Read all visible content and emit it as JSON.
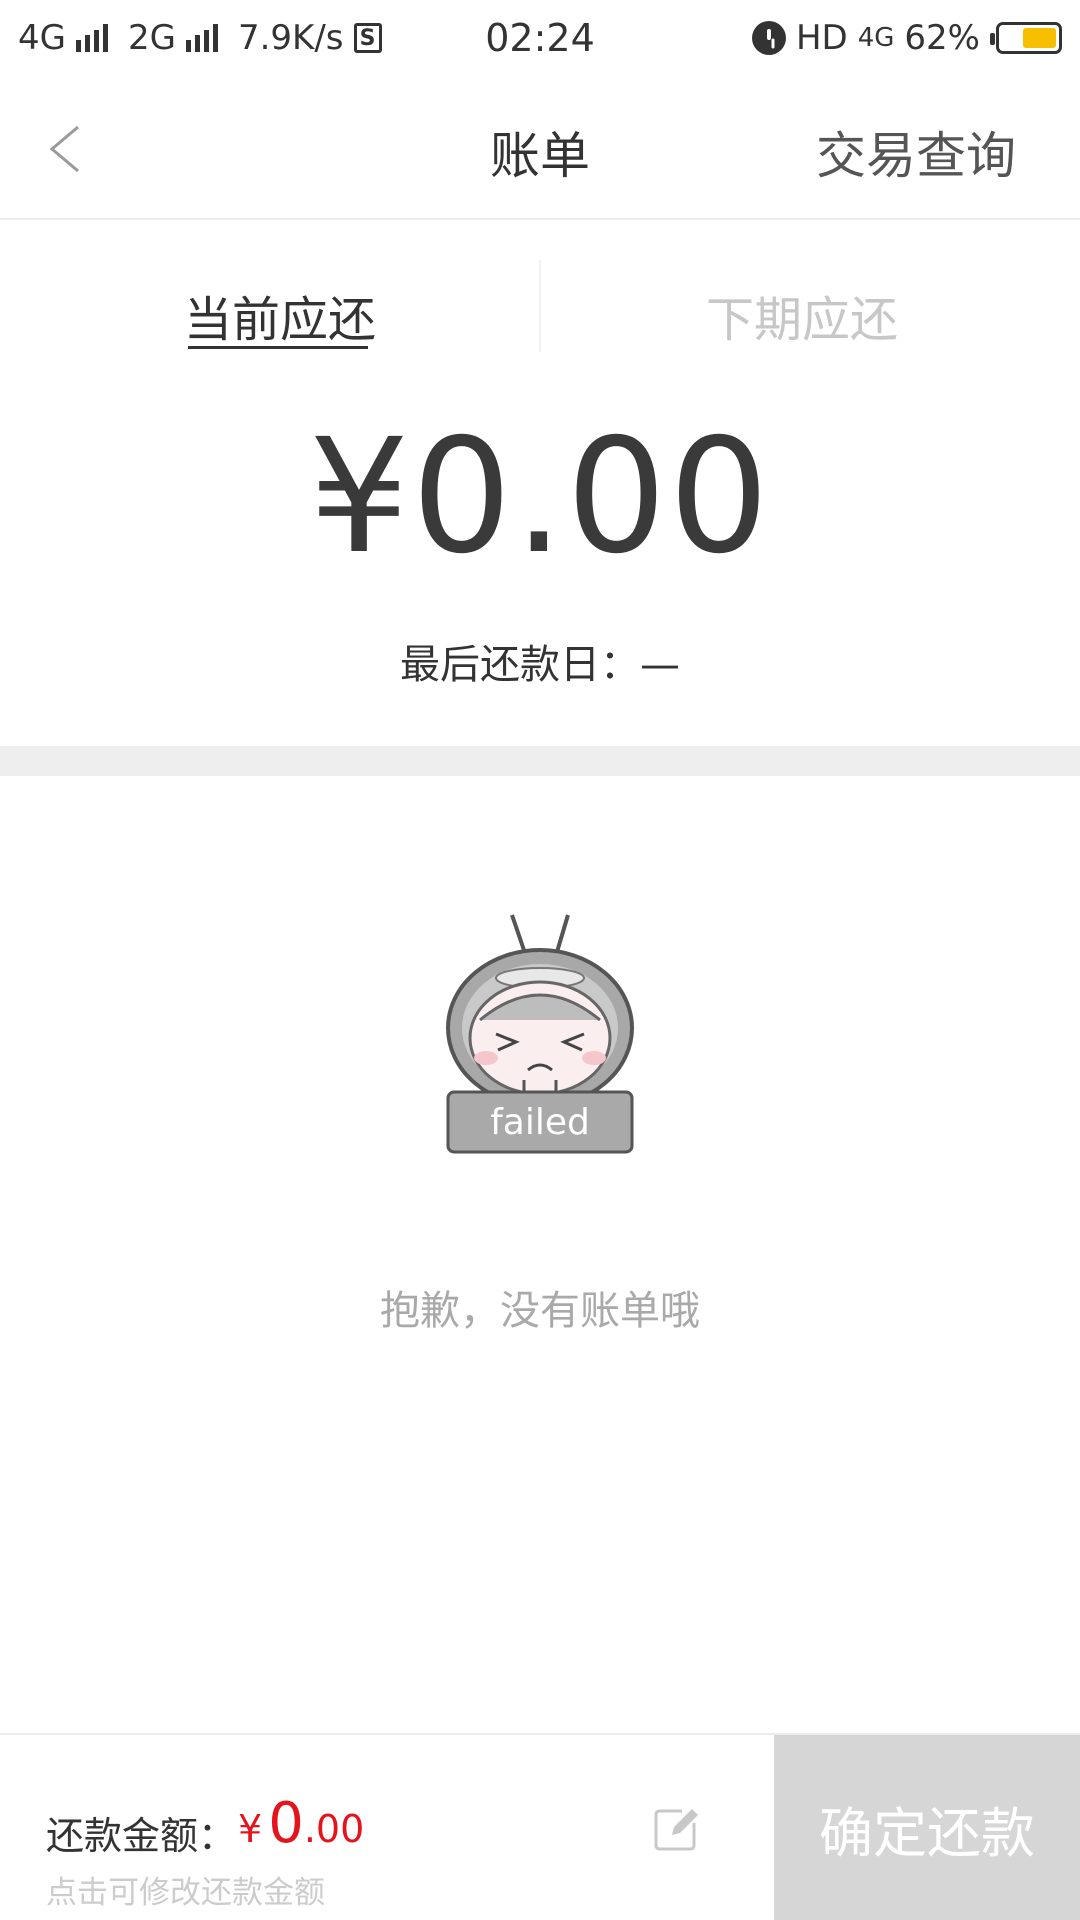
{
  "status_bar": {
    "network1": "4G",
    "network2": "2G",
    "speed": "7.9K/s",
    "s_icon_label": "S",
    "time": "02:24",
    "hd": "HD",
    "net_type": "4G",
    "battery": "62%",
    "battery_level": 0.62,
    "battery_color": "#f6c000"
  },
  "nav": {
    "title": "账单",
    "right_action": "交易查询",
    "back_icon": "chevron-left-icon"
  },
  "tabs": [
    {
      "label": "当前应还",
      "active": true
    },
    {
      "label": "下期应还",
      "active": false
    }
  ],
  "summary": {
    "amount": "¥0.00",
    "due_date_line": "最后还款日：—"
  },
  "empty_state": {
    "image_badge": "failed",
    "message": "抱歉，没有账单哦",
    "icon": "failed-mascot-illustration"
  },
  "bottom_bar": {
    "amount_label": "还款金额：",
    "currency": "¥",
    "amount_int": "0",
    "amount_dec": ".00",
    "hint": "点击可修改还款金额",
    "edit_icon": "edit-icon",
    "confirm_label": "确定还款"
  },
  "colors": {
    "accent_red": "#e4141c",
    "disabled_button": "#d6d6d6",
    "separator": "#eeeeee"
  }
}
